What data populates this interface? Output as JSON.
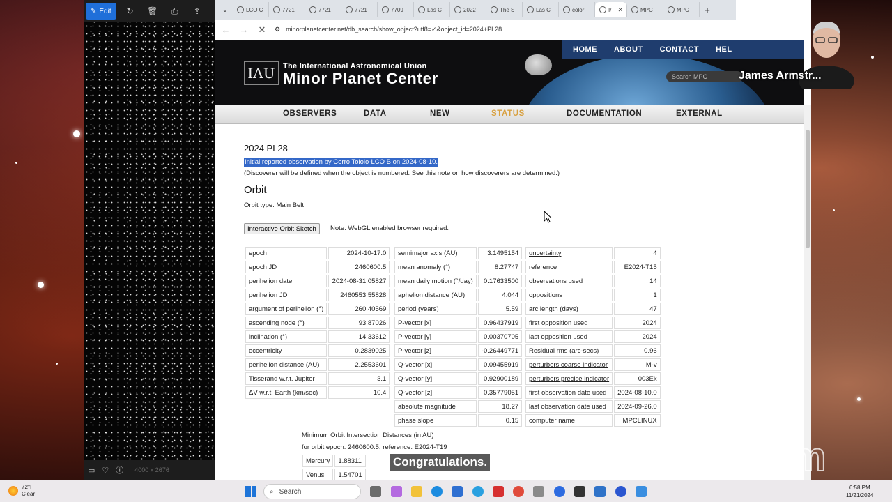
{
  "viewer": {
    "edit_label": "Edit",
    "dimensions": "4000 x 2676"
  },
  "browser": {
    "tabs": [
      {
        "label": "LCO C"
      },
      {
        "label": "7721"
      },
      {
        "label": "7721"
      },
      {
        "label": "7721"
      },
      {
        "label": "7709"
      },
      {
        "label": "Las C"
      },
      {
        "label": "2022"
      },
      {
        "label": "The S"
      },
      {
        "label": "Las C"
      },
      {
        "label": "color"
      },
      {
        "label": "I/"
      },
      {
        "label": "MPC"
      },
      {
        "label": "MPC"
      }
    ],
    "url": "minorplanetcenter.net/db_search/show_object?utf8=✓&object_id=2024+PL28"
  },
  "mpc": {
    "union_name": "The International Astronomical Union",
    "center_name": "Minor Planet Center",
    "iau_logo": "IAU",
    "topnav": [
      "HOME",
      "ABOUT",
      "CONTACT",
      "HEL"
    ],
    "search_placeholder": "Search MPC",
    "mainnav": [
      "OBSERVERS",
      "DATA",
      "NEW",
      "STATUS",
      "DOCUMENTATION",
      "EXTERNAL"
    ],
    "object_title": "2024 PL28",
    "initial_obs": "Initial reported observation by Cerro Tololo-LCO B on 2024-08-10.",
    "disc_note_pre": "(Discoverer will be defined when the object is numbered. See ",
    "disc_note_link": "this note",
    "disc_note_post": " on how discoverers are determined.)",
    "orbit_heading": "Orbit",
    "orbit_type": "Orbit type: Main Belt",
    "sketch_button": "Interactive Orbit Sketch",
    "webgl_note": "Note: WebGL enabled browser required."
  },
  "table1": [
    [
      "epoch",
      "2024-10-17.0"
    ],
    [
      "epoch JD",
      "2460600.5"
    ],
    [
      "perihelion date",
      "2024-08-31.05827"
    ],
    [
      "perihelion JD",
      "2460553.55828"
    ],
    [
      "argument of perihelion (°)",
      "260.40569"
    ],
    [
      "ascending node (°)",
      "93.87026"
    ],
    [
      "inclination (°)",
      "14.33612"
    ],
    [
      "eccentricity",
      "0.2839025"
    ],
    [
      "perihelion distance (AU)",
      "2.2553601"
    ],
    [
      "Tisserand w.r.t. Jupiter",
      "3.1"
    ],
    [
      "ΔV w.r.t. Earth (km/sec)",
      "10.4"
    ]
  ],
  "table2": [
    [
      "semimajor axis (AU)",
      "3.1495154"
    ],
    [
      "mean anomaly (°)",
      "8.27747"
    ],
    [
      "mean daily motion (°/day)",
      "0.17633500"
    ],
    [
      "aphelion distance (AU)",
      "4.044"
    ],
    [
      "period (years)",
      "5.59"
    ],
    [
      "P-vector [x]",
      "0.96437919"
    ],
    [
      "P-vector [y]",
      "0.00370705"
    ],
    [
      "P-vector [z]",
      "-0.26449771"
    ],
    [
      "Q-vector [x]",
      "0.09455919"
    ],
    [
      "Q-vector [y]",
      "0.92900189"
    ],
    [
      "Q-vector [z]",
      "0.35779051"
    ],
    [
      "absolute magnitude",
      "18.27"
    ],
    [
      "phase slope",
      "0.15"
    ]
  ],
  "table3": [
    [
      "uncertainty",
      "4"
    ],
    [
      "reference",
      "E2024-T15"
    ],
    [
      "observations used",
      "14"
    ],
    [
      "oppositions",
      "1"
    ],
    [
      "arc length (days)",
      "47"
    ],
    [
      "first opposition used",
      "2024"
    ],
    [
      "last opposition used",
      "2024"
    ],
    [
      "Residual rms (arc-secs)",
      "0.96"
    ],
    [
      "perturbers coarse indicator",
      "M-v"
    ],
    [
      "perturbers precise indicator",
      "003Ek"
    ],
    [
      "first observation date used",
      "2024-08-10.0"
    ],
    [
      "last observation date used",
      "2024-09-26.0"
    ],
    [
      "computer name",
      "MPCLINUX"
    ]
  ],
  "moid": {
    "heading": "Minimum Orbit Intersection Distances (in AU)",
    "subheading": "for orbit epoch: 2460600.5, reference: E2024-T19",
    "rows": [
      [
        "Mercury",
        "1.88311"
      ],
      [
        "Venus",
        "1.54701"
      ]
    ]
  },
  "overlay": {
    "presenter_name": "James Armstr...",
    "caption": "Congratulations.",
    "watermark": "zoom"
  },
  "taskbar": {
    "temperature": "72°F",
    "condition": "Clear",
    "search_label": "Search",
    "time": "6:58 PM",
    "date": "11/21/2024"
  },
  "colors": {
    "selection": "#3468c8",
    "status_nav": "#d8a040",
    "topnav_bg": "#1f3d6e"
  }
}
